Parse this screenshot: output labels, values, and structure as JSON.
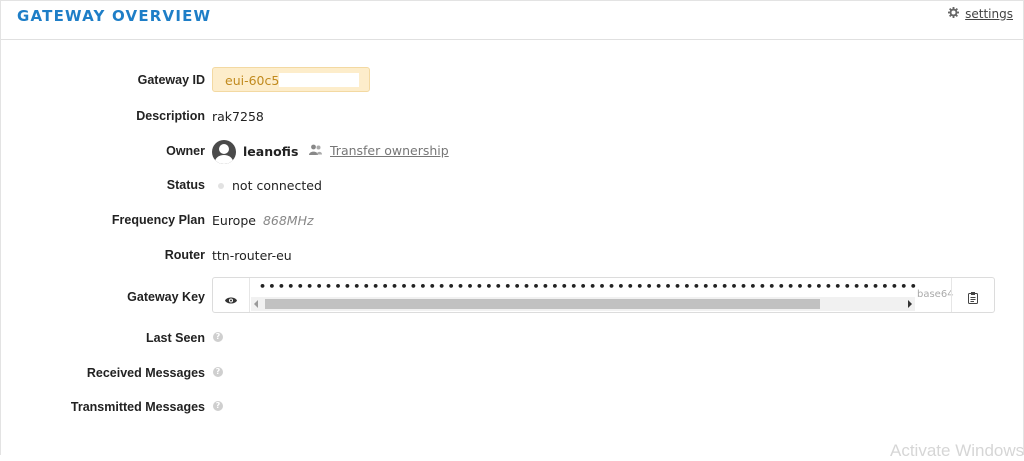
{
  "header": {
    "title": "GATEWAY OVERVIEW",
    "settings_label": "settings"
  },
  "fields": {
    "gateway_id": {
      "label": "Gateway ID",
      "value": "eui-60c5"
    },
    "description": {
      "label": "Description",
      "value": "rak7258"
    },
    "owner": {
      "label": "Owner",
      "value": "leanofis",
      "transfer_label": "Transfer ownership"
    },
    "status": {
      "label": "Status",
      "value": "not connected"
    },
    "frequency_plan": {
      "label": "Frequency Plan",
      "region": "Europe",
      "band": "868MHz"
    },
    "router": {
      "label": "Router",
      "value": "ttn-router-eu"
    },
    "gateway_key": {
      "label": "Gateway Key",
      "masked_value": "••••••••••••••••••••••••••••••••••••••••••••••••••••••••••••••••••••••••••••••••••••••••••••••••••••••••••••••••••••••••••••••••••••••••••••••••••••••••••••",
      "encoding": "base64"
    },
    "last_seen": {
      "label": "Last Seen"
    },
    "received_messages": {
      "label": "Received Messages"
    },
    "transmitted_messages": {
      "label": "Transmitted Messages"
    }
  },
  "icons": {
    "settings": "gear-icon",
    "owner_avatar": "user-avatar-icon",
    "transfer": "users-icon",
    "status": "status-dot-icon",
    "show_key": "eye-icon",
    "copy_key": "clipboard-icon",
    "help": "help-icon"
  },
  "colors": {
    "title": "#1e7ec7",
    "eui_background": "#fdedcb",
    "eui_text": "#c18a1e"
  },
  "os_watermark": "Activate Windows"
}
